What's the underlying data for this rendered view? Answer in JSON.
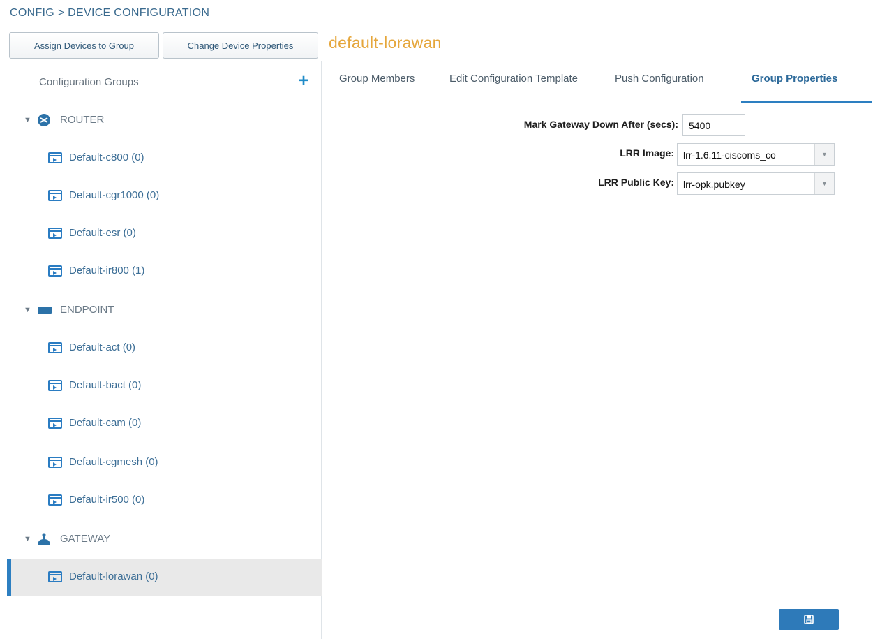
{
  "breadcrumb": "CONFIG > DEVICE CONFIGURATION",
  "toolbar": {
    "assign_label": "Assign Devices to Group",
    "change_label": "Change Device Properties"
  },
  "group_title": "default-lorawan",
  "sidebar": {
    "header": "Configuration Groups",
    "add_icon": "plus-icon",
    "categories": [
      {
        "label": "ROUTER",
        "icon": "router-icon",
        "items": [
          "Default-c800 (0)",
          "Default-cgr1000 (0)",
          "Default-esr (0)",
          "Default-ir800 (1)"
        ]
      },
      {
        "label": "ENDPOINT",
        "icon": "endpoint-icon",
        "items": [
          "Default-act (0)",
          "Default-bact (0)",
          "Default-cam (0)",
          "Default-cgmesh (0)",
          "Default-ir500 (0)"
        ]
      },
      {
        "label": "GATEWAY",
        "icon": "gateway-icon",
        "items": [
          "Default-lorawan (0)"
        ]
      }
    ],
    "selected_item": "Default-lorawan (0)"
  },
  "tabs": [
    {
      "label": "Group Members",
      "active": false
    },
    {
      "label": "Edit Configuration Template",
      "active": false
    },
    {
      "label": "Push Configuration",
      "active": false
    },
    {
      "label": "Group Properties",
      "active": true
    }
  ],
  "form": {
    "gateway_down_label": "Mark Gateway Down After (secs):",
    "gateway_down_value": "5400",
    "lrr_image_label": "LRR Image:",
    "lrr_image_value": "lrr-1.6.11-ciscoms_co",
    "lrr_key_label": "LRR Public Key:",
    "lrr_key_value": "lrr-opk.pubkey"
  },
  "colors": {
    "accent": "#2d7fc1",
    "title": "#e5a63b",
    "selected_row": "#e9e9e9"
  },
  "save_icon": "save-icon"
}
